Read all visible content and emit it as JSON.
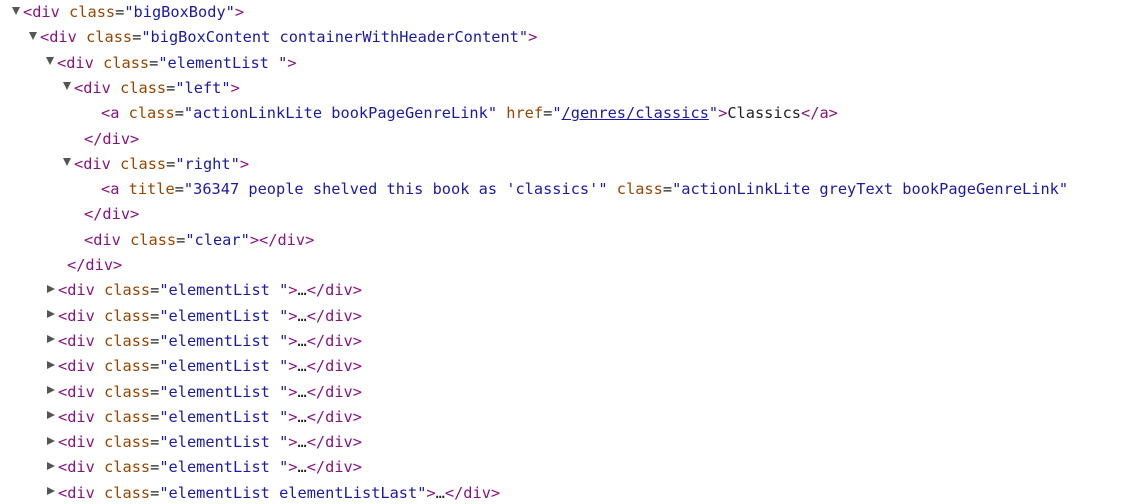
{
  "tree": {
    "rows": [
      {
        "indent": 0,
        "toggle": "open",
        "parts": [
          [
            "tag",
            "<div"
          ],
          [
            "text",
            " "
          ],
          [
            "attr",
            "class"
          ],
          [
            "text",
            "="
          ],
          [
            "val",
            "\"bigBoxBody\""
          ],
          [
            "tag",
            ">"
          ]
        ]
      },
      {
        "indent": 1,
        "toggle": "open",
        "parts": [
          [
            "tag",
            "<div"
          ],
          [
            "text",
            " "
          ],
          [
            "attr",
            "class"
          ],
          [
            "text",
            "="
          ],
          [
            "val",
            "\"bigBoxContent containerWithHeaderContent\""
          ],
          [
            "tag",
            ">"
          ]
        ]
      },
      {
        "indent": 2,
        "toggle": "open",
        "parts": [
          [
            "tag",
            "<div"
          ],
          [
            "text",
            " "
          ],
          [
            "attr",
            "class"
          ],
          [
            "text",
            "="
          ],
          [
            "val",
            "\"elementList \""
          ],
          [
            "tag",
            ">"
          ]
        ]
      },
      {
        "indent": 3,
        "toggle": "open",
        "parts": [
          [
            "tag",
            "<div"
          ],
          [
            "text",
            " "
          ],
          [
            "attr",
            "class"
          ],
          [
            "text",
            "="
          ],
          [
            "val",
            "\"left\""
          ],
          [
            "tag",
            ">"
          ]
        ]
      },
      {
        "indent": 4,
        "toggle": "none",
        "parts": [
          [
            "tag",
            "<a"
          ],
          [
            "text",
            " "
          ],
          [
            "attr",
            "class"
          ],
          [
            "text",
            "="
          ],
          [
            "val",
            "\"actionLinkLite bookPageGenreLink\""
          ],
          [
            "text",
            " "
          ],
          [
            "attr",
            "href"
          ],
          [
            "text",
            "="
          ],
          [
            "val",
            "\""
          ],
          [
            "link",
            "/genres/classics"
          ],
          [
            "val",
            "\""
          ],
          [
            "tag",
            ">"
          ],
          [
            "text",
            "Classics"
          ],
          [
            "tag",
            "</a>"
          ]
        ]
      },
      {
        "indent": 3,
        "toggle": "none",
        "parts": [
          [
            "tag",
            "</div>"
          ]
        ]
      },
      {
        "indent": 3,
        "toggle": "open",
        "parts": [
          [
            "tag",
            "<div"
          ],
          [
            "text",
            " "
          ],
          [
            "attr",
            "class"
          ],
          [
            "text",
            "="
          ],
          [
            "val",
            "\"right\""
          ],
          [
            "tag",
            ">"
          ]
        ]
      },
      {
        "indent": 4,
        "toggle": "none",
        "parts": [
          [
            "tag",
            "<a"
          ],
          [
            "text",
            " "
          ],
          [
            "attr",
            "title"
          ],
          [
            "text",
            "="
          ],
          [
            "val",
            "\"36347 people shelved this book as 'classics'\""
          ],
          [
            "text",
            " "
          ],
          [
            "attr",
            "class"
          ],
          [
            "text",
            "="
          ],
          [
            "val",
            "\"actionLinkLite greyText bookPageGenreLink\""
          ]
        ]
      },
      {
        "indent": 3,
        "toggle": "none",
        "parts": [
          [
            "tag",
            "</div>"
          ]
        ]
      },
      {
        "indent": 3,
        "toggle": "none",
        "parts": [
          [
            "tag",
            "<div"
          ],
          [
            "text",
            " "
          ],
          [
            "attr",
            "class"
          ],
          [
            "text",
            "="
          ],
          [
            "val",
            "\"clear\""
          ],
          [
            "tag",
            "></div>"
          ]
        ]
      },
      {
        "indent": 2,
        "toggle": "none",
        "parts": [
          [
            "tag",
            "</div>"
          ]
        ]
      },
      {
        "indent": 2,
        "toggle": "closed",
        "parts": [
          [
            "tag",
            "<div"
          ],
          [
            "text",
            " "
          ],
          [
            "attr",
            "class"
          ],
          [
            "text",
            "="
          ],
          [
            "val",
            "\"elementList \""
          ],
          [
            "tag",
            ">"
          ],
          [
            "text",
            "…"
          ],
          [
            "tag",
            "</div>"
          ]
        ]
      },
      {
        "indent": 2,
        "toggle": "closed",
        "parts": [
          [
            "tag",
            "<div"
          ],
          [
            "text",
            " "
          ],
          [
            "attr",
            "class"
          ],
          [
            "text",
            "="
          ],
          [
            "val",
            "\"elementList \""
          ],
          [
            "tag",
            ">"
          ],
          [
            "text",
            "…"
          ],
          [
            "tag",
            "</div>"
          ]
        ]
      },
      {
        "indent": 2,
        "toggle": "closed",
        "parts": [
          [
            "tag",
            "<div"
          ],
          [
            "text",
            " "
          ],
          [
            "attr",
            "class"
          ],
          [
            "text",
            "="
          ],
          [
            "val",
            "\"elementList \""
          ],
          [
            "tag",
            ">"
          ],
          [
            "text",
            "…"
          ],
          [
            "tag",
            "</div>"
          ]
        ]
      },
      {
        "indent": 2,
        "toggle": "closed",
        "parts": [
          [
            "tag",
            "<div"
          ],
          [
            "text",
            " "
          ],
          [
            "attr",
            "class"
          ],
          [
            "text",
            "="
          ],
          [
            "val",
            "\"elementList \""
          ],
          [
            "tag",
            ">"
          ],
          [
            "text",
            "…"
          ],
          [
            "tag",
            "</div>"
          ]
        ]
      },
      {
        "indent": 2,
        "toggle": "closed",
        "parts": [
          [
            "tag",
            "<div"
          ],
          [
            "text",
            " "
          ],
          [
            "attr",
            "class"
          ],
          [
            "text",
            "="
          ],
          [
            "val",
            "\"elementList \""
          ],
          [
            "tag",
            ">"
          ],
          [
            "text",
            "…"
          ],
          [
            "tag",
            "</div>"
          ]
        ]
      },
      {
        "indent": 2,
        "toggle": "closed",
        "parts": [
          [
            "tag",
            "<div"
          ],
          [
            "text",
            " "
          ],
          [
            "attr",
            "class"
          ],
          [
            "text",
            "="
          ],
          [
            "val",
            "\"elementList \""
          ],
          [
            "tag",
            ">"
          ],
          [
            "text",
            "…"
          ],
          [
            "tag",
            "</div>"
          ]
        ]
      },
      {
        "indent": 2,
        "toggle": "closed",
        "parts": [
          [
            "tag",
            "<div"
          ],
          [
            "text",
            " "
          ],
          [
            "attr",
            "class"
          ],
          [
            "text",
            "="
          ],
          [
            "val",
            "\"elementList \""
          ],
          [
            "tag",
            ">"
          ],
          [
            "text",
            "…"
          ],
          [
            "tag",
            "</div>"
          ]
        ]
      },
      {
        "indent": 2,
        "toggle": "closed",
        "parts": [
          [
            "tag",
            "<div"
          ],
          [
            "text",
            " "
          ],
          [
            "attr",
            "class"
          ],
          [
            "text",
            "="
          ],
          [
            "val",
            "\"elementList \""
          ],
          [
            "tag",
            ">"
          ],
          [
            "text",
            "…"
          ],
          [
            "tag",
            "</div>"
          ]
        ]
      },
      {
        "indent": 2,
        "toggle": "closed",
        "parts": [
          [
            "tag",
            "<div"
          ],
          [
            "text",
            " "
          ],
          [
            "attr",
            "class"
          ],
          [
            "text",
            "="
          ],
          [
            "val",
            "\"elementList elementListLast\""
          ],
          [
            "tag",
            ">"
          ],
          [
            "text",
            "…"
          ],
          [
            "tag",
            "</div>"
          ]
        ]
      }
    ]
  },
  "colors": {
    "tag": "#881280",
    "attribute_name": "#994500",
    "attribute_value": "#1a1aa6",
    "text": "#222222",
    "toggle": "#555555"
  }
}
